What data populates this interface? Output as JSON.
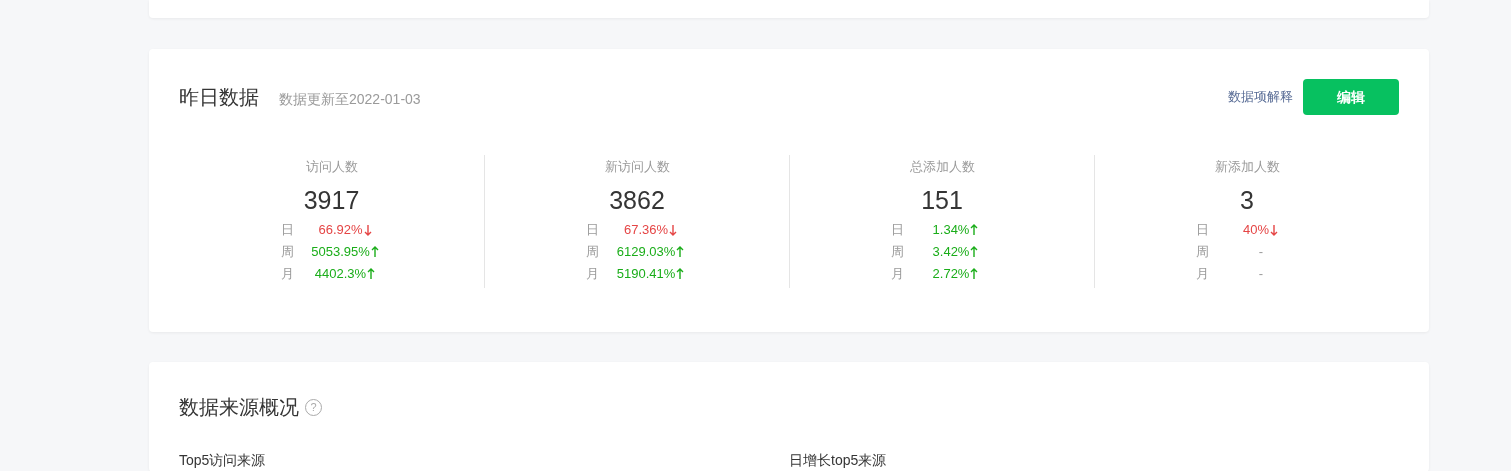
{
  "yesterday": {
    "title": "昨日数据",
    "updated": "数据更新至2022-01-03",
    "help_link": "数据项解释",
    "edit_button": "编辑",
    "metrics": [
      {
        "label": "访问人数",
        "value": "3917",
        "changes": [
          {
            "period": "日",
            "value": "66.92%",
            "kind": "down"
          },
          {
            "period": "周",
            "value": "5053.95%",
            "kind": "up"
          },
          {
            "period": "月",
            "value": "4402.3%",
            "kind": "up"
          }
        ]
      },
      {
        "label": "新访问人数",
        "value": "3862",
        "changes": [
          {
            "period": "日",
            "value": "67.36%",
            "kind": "down"
          },
          {
            "period": "周",
            "value": "6129.03%",
            "kind": "up"
          },
          {
            "period": "月",
            "value": "5190.41%",
            "kind": "up"
          }
        ]
      },
      {
        "label": "总添加人数",
        "value": "151",
        "changes": [
          {
            "period": "日",
            "value": "1.34%",
            "kind": "up"
          },
          {
            "period": "周",
            "value": "3.42%",
            "kind": "up"
          },
          {
            "period": "月",
            "value": "2.72%",
            "kind": "up"
          }
        ]
      },
      {
        "label": "新添加人数",
        "value": "3",
        "changes": [
          {
            "period": "日",
            "value": "40%",
            "kind": "down"
          },
          {
            "period": "周",
            "value": "-",
            "kind": "none"
          },
          {
            "period": "月",
            "value": "-",
            "kind": "none"
          }
        ]
      }
    ]
  },
  "sources": {
    "title": "数据来源概况",
    "help_icon": "?",
    "subtitles": [
      "Top5访问来源",
      "日增长top5来源"
    ]
  }
}
